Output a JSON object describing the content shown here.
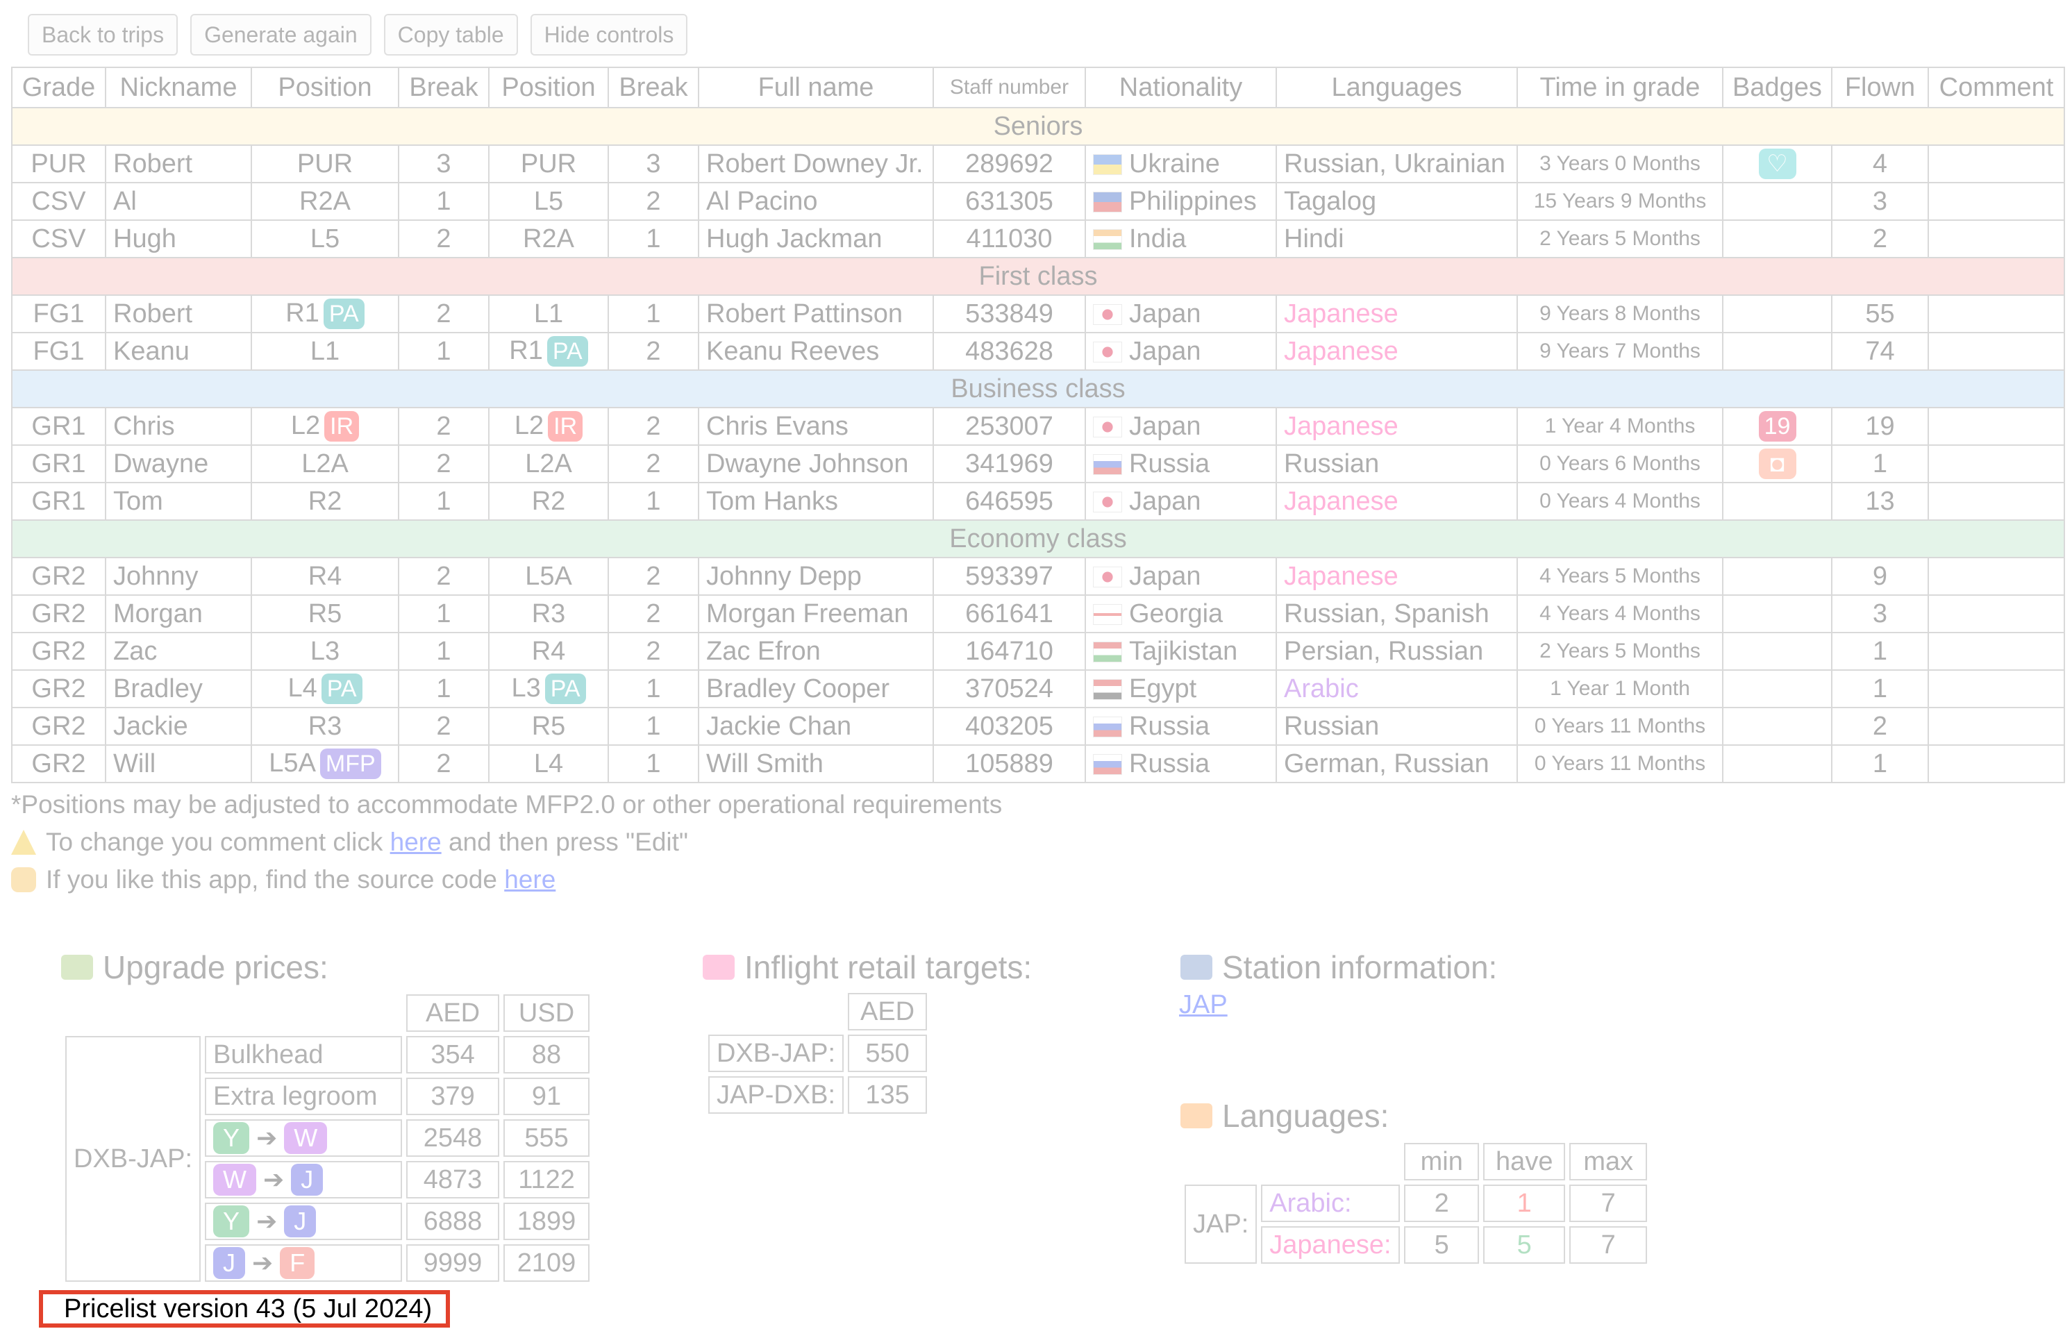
{
  "controls": [
    "Back to trips",
    "Generate again",
    "Copy table",
    "Hide controls"
  ],
  "columns": [
    "Grade",
    "Nickname",
    "Position",
    "Break",
    "Position",
    "Break",
    "Full name",
    "Staff number",
    "Nationality",
    "Languages",
    "Time in grade",
    "Badges",
    "Flown",
    "Comment"
  ],
  "sections": [
    {
      "title": "Seniors",
      "key": "seniors",
      "rows": [
        {
          "grade": "PUR",
          "nick": "Robert",
          "pos1": "PUR",
          "tag1": "",
          "brk1": "3",
          "pos2": "PUR",
          "tag2": "",
          "brk2": "3",
          "name": "Robert Downey Jr.",
          "staff": "289692",
          "flag": "ukraine",
          "nat": "Ukraine",
          "lang": "Russian, Ukrainian",
          "lang_style": "plain",
          "time": "3 Years 0 Months",
          "badge": "heart",
          "badge_color": "#3cc9c9",
          "badge_text": "♡",
          "flown": "4",
          "comment": ""
        },
        {
          "grade": "CSV",
          "nick": "Al",
          "pos1": "R2A",
          "tag1": "",
          "brk1": "1",
          "pos2": "L5",
          "tag2": "",
          "brk2": "2",
          "name": "Al Pacino",
          "staff": "631305",
          "flag": "philippines",
          "nat": "Philippines",
          "lang": "Tagalog",
          "lang_style": "plain",
          "time": "15 Years 9 Months",
          "badge": "",
          "badge_color": "",
          "badge_text": "",
          "flown": "3",
          "comment": ""
        },
        {
          "grade": "CSV",
          "nick": "Hugh",
          "pos1": "L5",
          "tag1": "",
          "brk1": "2",
          "pos2": "R2A",
          "tag2": "",
          "brk2": "1",
          "name": "Hugh Jackman",
          "staff": "411030",
          "flag": "india",
          "nat": "India",
          "lang": "Hindi",
          "lang_style": "plain",
          "time": "2 Years 5 Months",
          "badge": "",
          "badge_color": "",
          "badge_text": "",
          "flown": "2",
          "comment": ""
        }
      ]
    },
    {
      "title": "First class",
      "key": "first",
      "rows": [
        {
          "grade": "FG1",
          "nick": "Robert",
          "pos1": "R1",
          "tag1": "PA",
          "brk1": "2",
          "pos2": "L1",
          "tag2": "",
          "brk2": "1",
          "name": "Robert Pattinson",
          "staff": "533849",
          "flag": "japan",
          "nat": "Japan",
          "lang": "Japanese",
          "lang_style": "jp",
          "time": "9 Years 8 Months",
          "badge": "",
          "badge_color": "",
          "badge_text": "",
          "flown": "55",
          "comment": ""
        },
        {
          "grade": "FG1",
          "nick": "Keanu",
          "pos1": "L1",
          "tag1": "",
          "brk1": "1",
          "pos2": "R1",
          "tag2": "PA",
          "brk2": "2",
          "name": "Keanu Reeves",
          "staff": "483628",
          "flag": "japan",
          "nat": "Japan",
          "lang": "Japanese",
          "lang_style": "jp",
          "time": "9 Years 7 Months",
          "badge": "",
          "badge_color": "",
          "badge_text": "",
          "flown": "74",
          "comment": ""
        }
      ]
    },
    {
      "title": "Business class",
      "key": "business",
      "rows": [
        {
          "grade": "GR1",
          "nick": "Chris",
          "pos1": "L2",
          "tag1": "IR",
          "brk1": "2",
          "pos2": "L2",
          "tag2": "IR",
          "brk2": "2",
          "name": "Chris Evans",
          "staff": "253007",
          "flag": "japan",
          "nat": "Japan",
          "lang": "Japanese",
          "lang_style": "jp",
          "time": "1 Year 4 Months",
          "badge": "number",
          "badge_color": "#e8264f",
          "badge_text": "19",
          "flown": "19",
          "comment": ""
        },
        {
          "grade": "GR1",
          "nick": "Dwayne",
          "pos1": "L2A",
          "tag1": "",
          "brk1": "2",
          "pos2": "L2A",
          "tag2": "",
          "brk2": "2",
          "name": "Dwayne Johnson",
          "staff": "341969",
          "flag": "russia",
          "nat": "Russia",
          "lang": "Russian",
          "lang_style": "plain",
          "time": "0 Years 6 Months",
          "badge": "camera",
          "badge_color": "#ff8a65",
          "badge_text": "◘",
          "flown": "1",
          "comment": ""
        },
        {
          "grade": "GR1",
          "nick": "Tom",
          "pos1": "R2",
          "tag1": "",
          "brk1": "1",
          "pos2": "R2",
          "tag2": "",
          "brk2": "1",
          "name": "Tom Hanks",
          "staff": "646595",
          "flag": "japan",
          "nat": "Japan",
          "lang": "Japanese",
          "lang_style": "jp",
          "time": "0 Years 4 Months",
          "badge": "",
          "badge_color": "",
          "badge_text": "",
          "flown": "13",
          "comment": ""
        }
      ]
    },
    {
      "title": "Economy class",
      "key": "economy",
      "rows": [
        {
          "grade": "GR2",
          "nick": "Johnny",
          "pos1": "R4",
          "tag1": "",
          "brk1": "2",
          "pos2": "L5A",
          "tag2": "",
          "brk2": "2",
          "name": "Johnny Depp",
          "staff": "593397",
          "flag": "japan",
          "nat": "Japan",
          "lang": "Japanese",
          "lang_style": "jp",
          "time": "4 Years 5 Months",
          "badge": "",
          "badge_color": "",
          "badge_text": "",
          "flown": "9",
          "comment": ""
        },
        {
          "grade": "GR2",
          "nick": "Morgan",
          "pos1": "R5",
          "tag1": "",
          "brk1": "1",
          "pos2": "R3",
          "tag2": "",
          "brk2": "2",
          "name": "Morgan Freeman",
          "staff": "661641",
          "flag": "georgia",
          "nat": "Georgia",
          "lang": "Russian, Spanish",
          "lang_style": "plain",
          "time": "4 Years 4 Months",
          "badge": "",
          "badge_color": "",
          "badge_text": "",
          "flown": "3",
          "comment": ""
        },
        {
          "grade": "GR2",
          "nick": "Zac",
          "pos1": "L3",
          "tag1": "",
          "brk1": "1",
          "pos2": "R4",
          "tag2": "",
          "brk2": "2",
          "name": "Zac Efron",
          "staff": "164710",
          "flag": "tajikistan",
          "nat": "Tajikistan",
          "lang": "Persian, Russian",
          "lang_style": "plain",
          "time": "2 Years 5 Months",
          "badge": "",
          "badge_color": "",
          "badge_text": "",
          "flown": "1",
          "comment": ""
        },
        {
          "grade": "GR2",
          "nick": "Bradley",
          "pos1": "L4",
          "tag1": "PA",
          "brk1": "1",
          "pos2": "L3",
          "tag2": "PA",
          "brk2": "1",
          "name": "Bradley Cooper",
          "staff": "370524",
          "flag": "egypt",
          "nat": "Egypt",
          "lang": "Arabic",
          "lang_style": "ar",
          "time": "1 Year 1 Month",
          "badge": "",
          "badge_color": "",
          "badge_text": "",
          "flown": "1",
          "comment": ""
        },
        {
          "grade": "GR2",
          "nick": "Jackie",
          "pos1": "R3",
          "tag1": "",
          "brk1": "2",
          "pos2": "R5",
          "tag2": "",
          "brk2": "1",
          "name": "Jackie Chan",
          "staff": "403205",
          "flag": "russia",
          "nat": "Russia",
          "lang": "Russian",
          "lang_style": "plain",
          "time": "0 Years 11 Months",
          "badge": "",
          "badge_color": "",
          "badge_text": "",
          "flown": "2",
          "comment": ""
        },
        {
          "grade": "GR2",
          "nick": "Will",
          "pos1": "L5A",
          "tag1": "MFP",
          "brk1": "2",
          "pos2": "L4",
          "tag2": "",
          "brk2": "1",
          "name": "Will Smith",
          "staff": "105889",
          "flag": "russia",
          "nat": "Russia",
          "lang": "German, Russian",
          "lang_style": "plain",
          "time": "0 Years 11 Months",
          "badge": "",
          "badge_color": "",
          "badge_text": "",
          "flown": "1",
          "comment": ""
        }
      ]
    }
  ],
  "notes": {
    "positions": "*Positions may be adjusted to accommodate MFP2.0 or other operational requirements",
    "change_pre": "To change you comment click ",
    "change_link": "here",
    "change_post": " and then press \"Edit\"",
    "source_pre": "If you like this app, find the source code ",
    "source_link": "here"
  },
  "upgrade": {
    "heading": "Upgrade prices:",
    "col_aed": "AED",
    "col_usd": "USD",
    "route": "DXB-JAP:",
    "rows": [
      {
        "label": "Bulkhead",
        "from": "",
        "to": "",
        "aed": "354",
        "usd": "88"
      },
      {
        "label": "Extra legroom",
        "from": "",
        "to": "",
        "aed": "379",
        "usd": "91"
      },
      {
        "label": "",
        "from": "Y",
        "to": "W",
        "aed": "2548",
        "usd": "555"
      },
      {
        "label": "",
        "from": "W",
        "to": "J",
        "aed": "4873",
        "usd": "1122"
      },
      {
        "label": "",
        "from": "Y",
        "to": "J",
        "aed": "6888",
        "usd": "1899"
      },
      {
        "label": "",
        "from": "J",
        "to": "F",
        "aed": "9999",
        "usd": "2109"
      }
    ]
  },
  "retail": {
    "heading": "Inflight retail targets:",
    "col_aed": "AED",
    "rows": [
      {
        "route": "DXB-JAP:",
        "aed": "550"
      },
      {
        "route": "JAP-DXB:",
        "aed": "135"
      }
    ]
  },
  "station": {
    "heading": "Station information:",
    "link": "JAP"
  },
  "languages": {
    "heading": "Languages:",
    "col_min": "min",
    "col_have": "have",
    "col_max": "max",
    "station": "JAP:",
    "rows": [
      {
        "lang": "Arabic:",
        "style": "ar",
        "min": "2",
        "have": "1",
        "have_style": "red",
        "max": "7"
      },
      {
        "lang": "Japanese:",
        "style": "jp",
        "min": "5",
        "have": "5",
        "have_style": "green",
        "max": "7"
      }
    ]
  },
  "pricelist": "Pricelist version 43 (5 Jul 2024)",
  "colors": {
    "highlight_border": "#e3422c",
    "link": "#1a3cff",
    "japanese": "#ff2f9a",
    "arabic": "#9b3fe0"
  }
}
